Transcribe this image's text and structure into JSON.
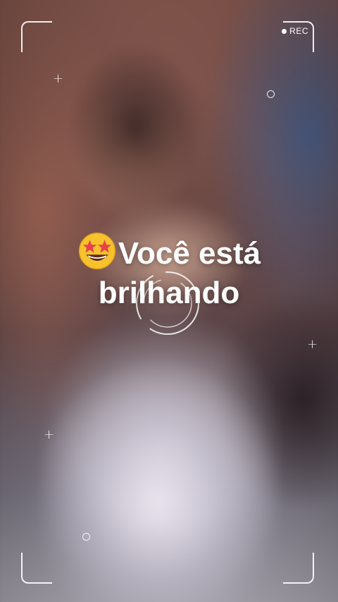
{
  "overlay": {
    "rec_label": "REC",
    "caption_emoji": "star-struck-emoji",
    "caption_line1": "Você está",
    "caption_line2": "brilhando"
  },
  "colors": {
    "overlay_white": "#ffffff",
    "emoji_face": "#F7C22C",
    "emoji_star": "#E8404B"
  }
}
